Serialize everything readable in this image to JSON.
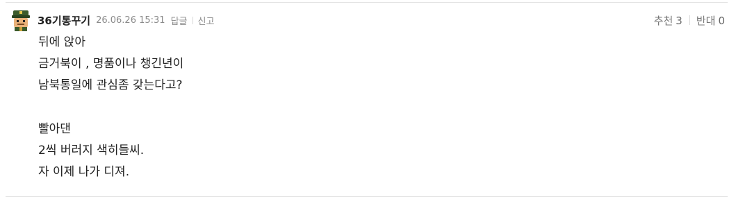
{
  "comment": {
    "author": {
      "nickname": "36기통꾸기",
      "avatar_icon": "soldier-avatar-icon"
    },
    "datetime": "26.06.26 15:31",
    "actions": {
      "reply_label": "답글",
      "report_label": "신고"
    },
    "votes": {
      "recommend_label": "추천",
      "recommend_count": "3",
      "oppose_label": "반대",
      "oppose_count": "0"
    },
    "body_lines": [
      "뒤에 앉아",
      "금거북이 , 명품이나 챙긴년이",
      "남북통일에 관심좀 갖는다고?",
      "",
      "빨아댄",
      "2씩 버러지 색히들씨.",
      "자 이제 나가 디져."
    ]
  },
  "colors": {
    "text": "#222222",
    "meta": "#8a8a8a",
    "divider": "#e3e3e3",
    "avatar_cap": "#3a5a2a",
    "avatar_skin": "#e9b27a"
  }
}
